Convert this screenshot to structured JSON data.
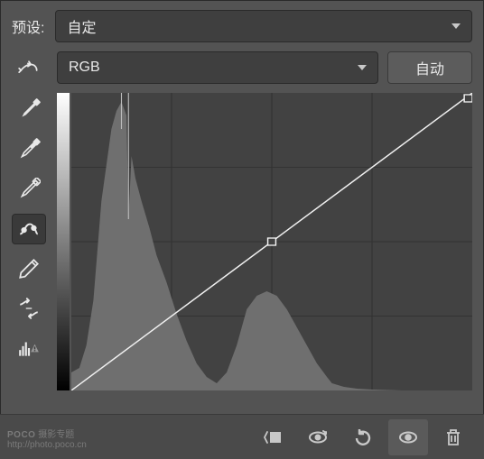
{
  "preset": {
    "label": "预设:",
    "value": "自定"
  },
  "channel": {
    "value": "RGB"
  },
  "auto_label": "自动",
  "tools": {
    "smear": "smear-tool",
    "eyedropper_black": "black-point-eyedropper",
    "eyedropper_gray": "gray-point-eyedropper",
    "eyedropper_white": "white-point-eyedropper",
    "curve_point": "curve-point-tool",
    "pencil": "pencil-tool",
    "smooth": "smooth-tool",
    "histogram_warn": "histogram-warning"
  },
  "bottom": {
    "clip": "clip-to-layer",
    "view_previous": "view-previous-state",
    "reset": "reset-to-default",
    "toggle_visibility": "toggle-visibility",
    "delete": "delete-adjustment"
  },
  "watermark": {
    "brand": "POCO",
    "tagline": "摄影专题",
    "url": "http://photo.poco.cn"
  },
  "chart_data": {
    "type": "curve-with-histogram",
    "x_range": [
      0,
      255
    ],
    "y_range": [
      0,
      255
    ],
    "grid_divisions": 4,
    "curve_points": [
      {
        "x": 0,
        "y": 0
      },
      {
        "x": 128,
        "y": 128
      },
      {
        "x": 255,
        "y": 255
      }
    ],
    "histogram_peaks_approx": [
      {
        "x": 30,
        "height_pct": 95
      },
      {
        "x": 45,
        "height_pct": 70
      },
      {
        "x": 110,
        "height_pct": 45
      },
      {
        "x": 170,
        "height_pct": 12
      }
    ]
  }
}
